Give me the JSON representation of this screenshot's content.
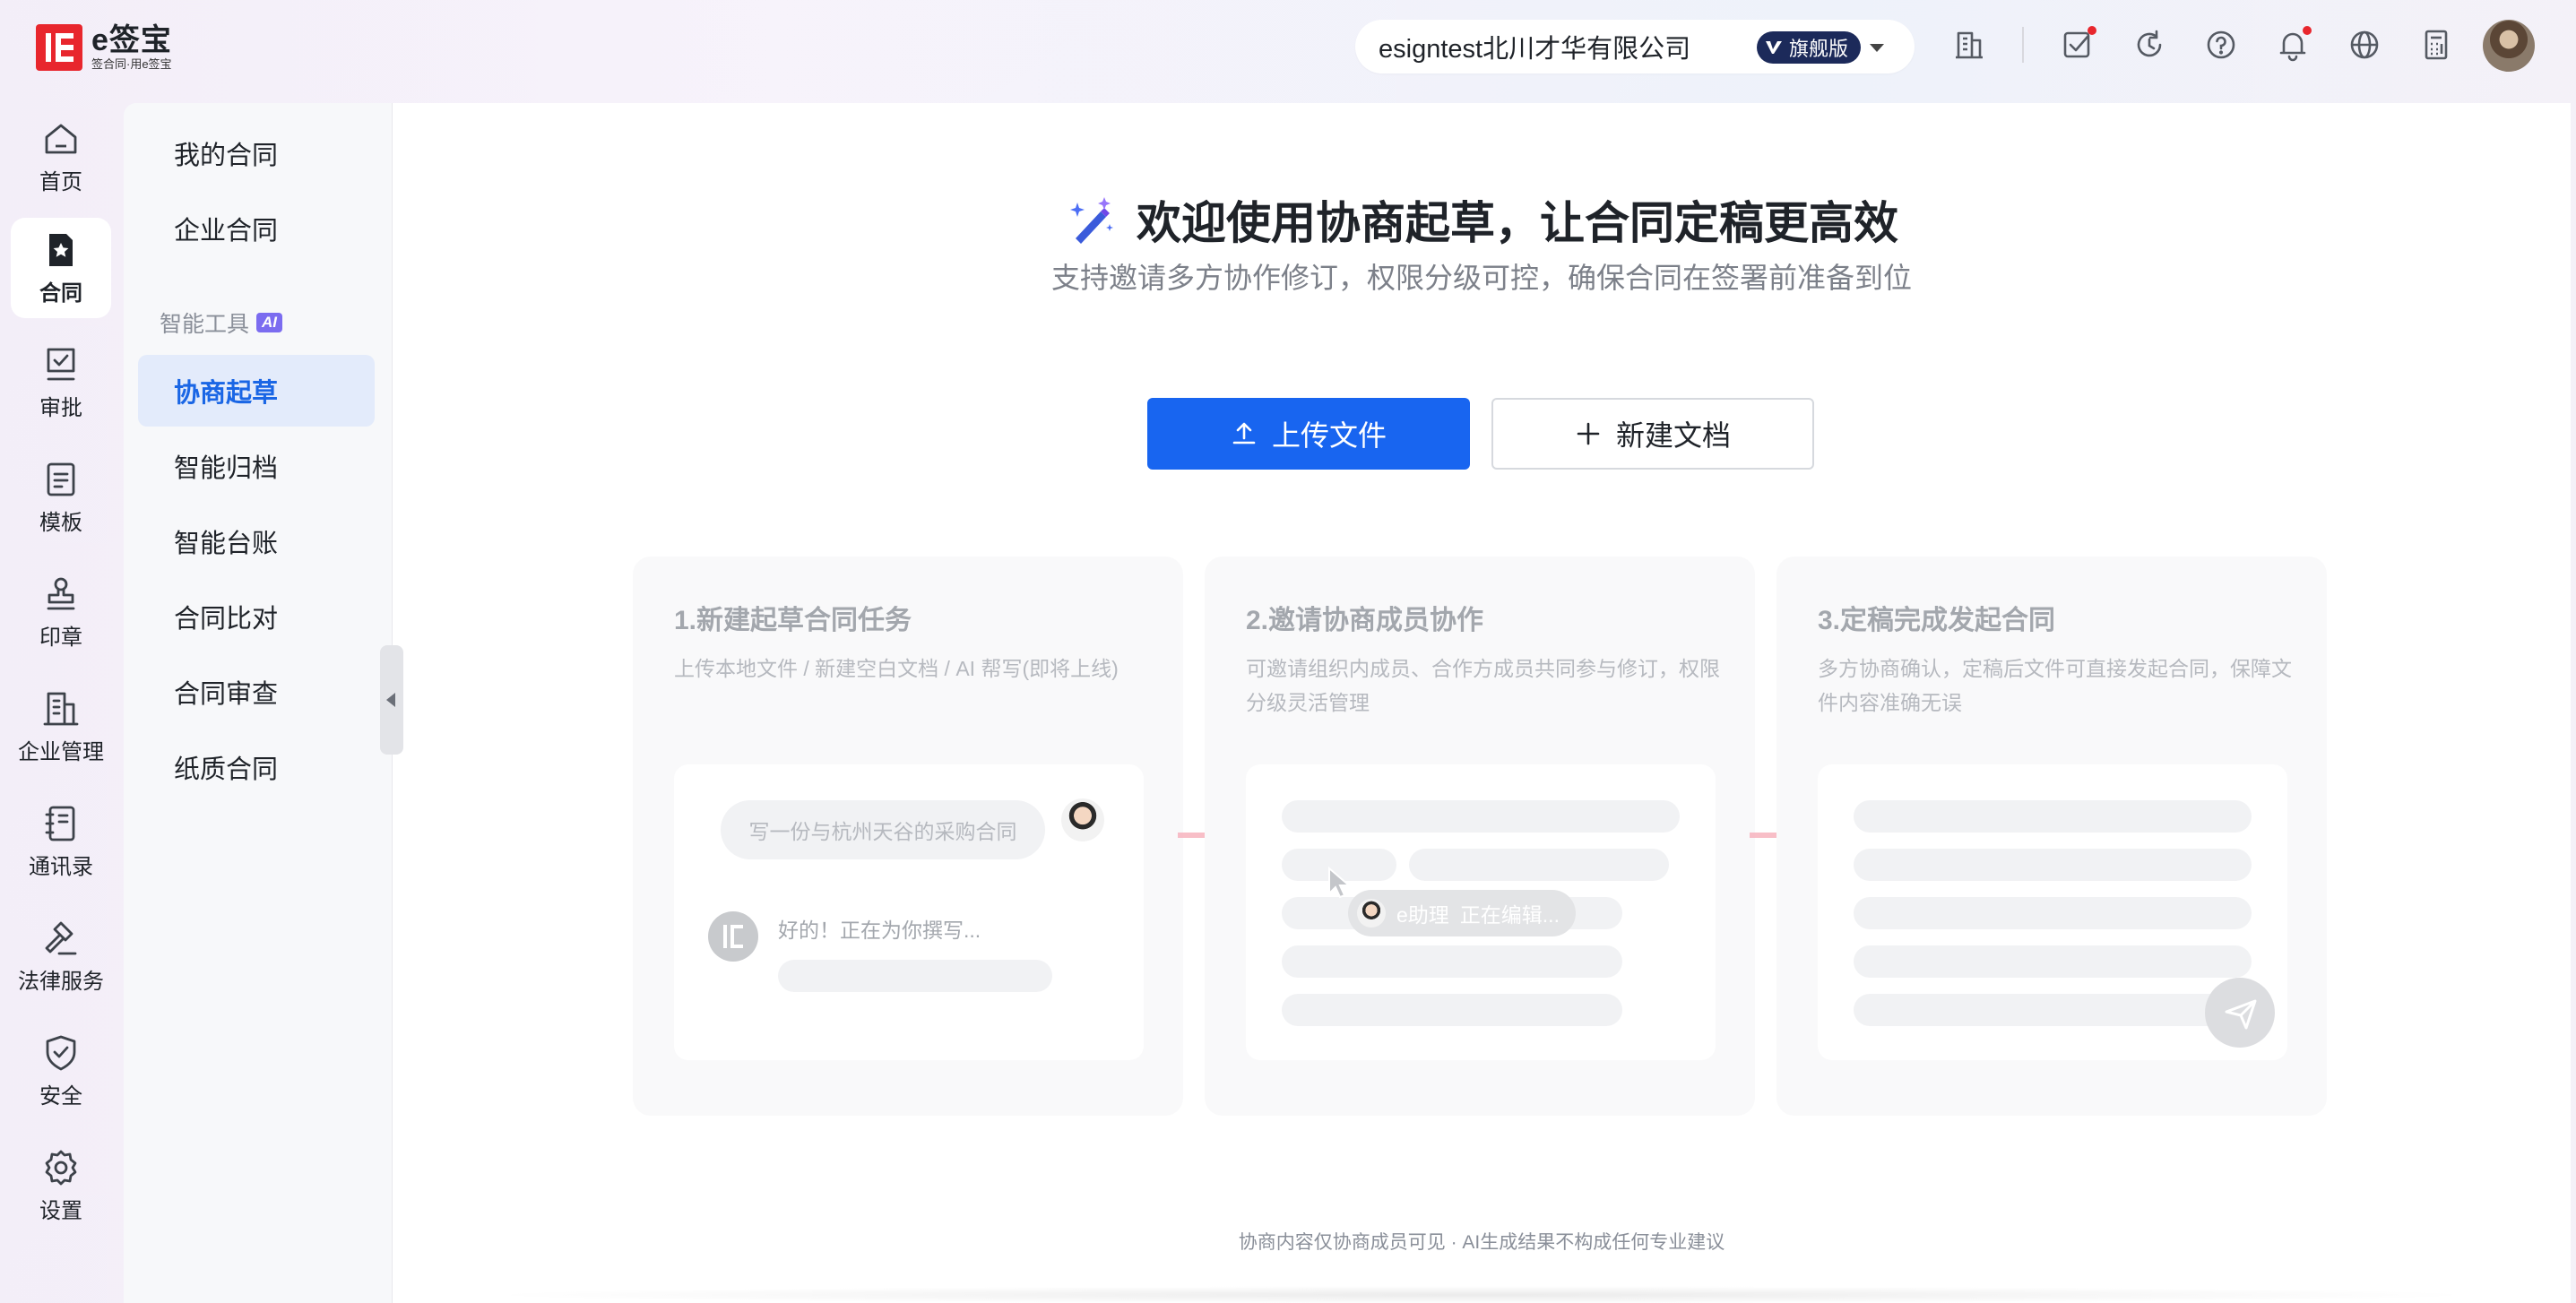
{
  "brand": {
    "name": "e签宝",
    "slogan": "签合同·用e签宝",
    "accent": "#e8262d"
  },
  "topbar": {
    "company": "esigntest北川才华有限公司",
    "edition": "旗舰版",
    "icons": [
      "building-icon",
      "task-check-icon",
      "refresh-icon",
      "help-icon",
      "bell-icon",
      "globe-icon",
      "calculator-icon"
    ]
  },
  "rail": {
    "items": [
      {
        "label": "首页",
        "icon": "home-icon"
      },
      {
        "label": "合同",
        "icon": "contract-icon",
        "active": true
      },
      {
        "label": "审批",
        "icon": "approval-icon"
      },
      {
        "label": "模板",
        "icon": "template-icon"
      },
      {
        "label": "印章",
        "icon": "seal-icon"
      },
      {
        "label": "企业管理",
        "icon": "enterprise-icon"
      },
      {
        "label": "通讯录",
        "icon": "contacts-icon"
      },
      {
        "label": "法律服务",
        "icon": "legal-icon"
      },
      {
        "label": "安全",
        "icon": "shield-icon"
      },
      {
        "label": "设置",
        "icon": "settings-icon"
      }
    ]
  },
  "subnav": {
    "items_top": [
      "我的合同",
      "企业合同"
    ],
    "group_label": "智能工具",
    "group_badge": "AI",
    "items": [
      "协商起草",
      "智能归档",
      "智能台账",
      "合同比对",
      "合同审查",
      "纸质合同"
    ],
    "active": "协商起草"
  },
  "main": {
    "title": "欢迎使用协商起草，让合同定稿更高效",
    "subtitle": "支持邀请多方协作修订，权限分级可控，确保合同在签署前准备到位",
    "upload_label": "上传文件",
    "new_doc_label": "新建文档",
    "primary_color": "#1865f0",
    "steps": [
      {
        "title": "1.新建起草合同任务",
        "desc": "上传本地文件 / 新建空白文档 / AI 帮写(即将上线)",
        "chat_prompt": "写一份与杭州天谷的采购合同",
        "bot_reply": "好的！正在为你撰写..."
      },
      {
        "title": "2.邀请协商成员协作",
        "desc": "可邀请组织内成员、合作方成员共同参与修订，权限分级灵活管理",
        "editing_name": "e助理",
        "editing_status": "正在编辑..."
      },
      {
        "title": "3.定稿完成发起合同",
        "desc": "多方协商确认，定稿后文件可直接发起合同，保障文件内容准确无误"
      }
    ],
    "footnote": "协商内容仅协商成员可见 · AI生成结果不构成任何专业建议"
  }
}
